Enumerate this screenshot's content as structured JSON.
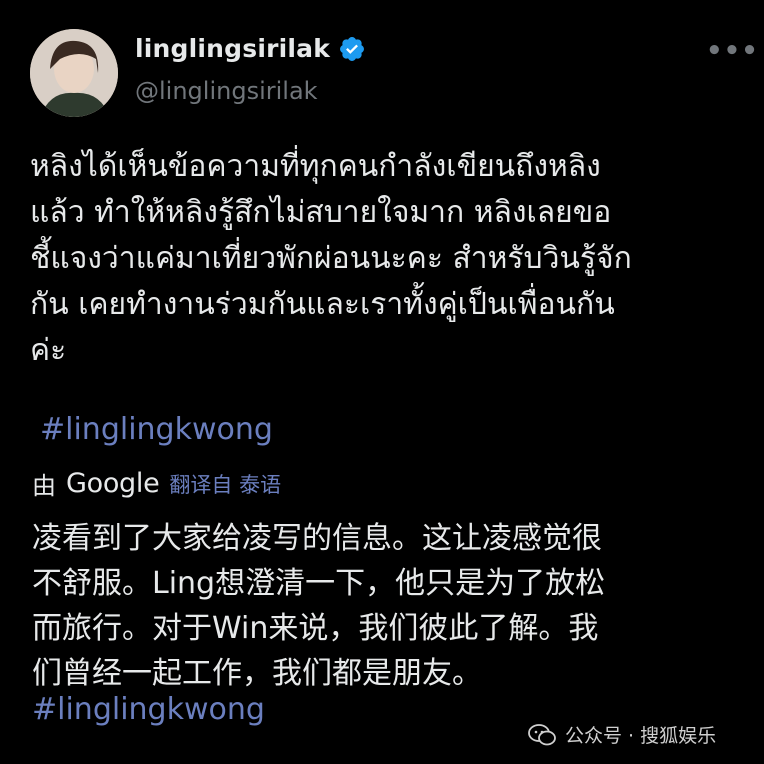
{
  "author": {
    "display_name": "linglingsirilak",
    "handle": "@linglingsirilak"
  },
  "more_icon": "ellipsis-icon",
  "verified_icon": "verified-badge-icon",
  "tweet": {
    "thai_lines": [
      "หลิงได้เห็นข้อความที่ทุกคนกำลังเขียนถึงหลิง",
      "แล้ว ทำให้หลิงรู้สึกไม่สบายใจมาก หลิงเลยขอ",
      "ชี้แจงว่าแค่มาเที่ยวพักผ่อนนะคะ สำหรับวินรู้จัก",
      "กัน เคยทำงานร่วมกันและเราทั้งคู่เป็นเพื่อนกัน",
      "ค่ะ"
    ],
    "hashtag": "#linglingkwong"
  },
  "translation": {
    "by_label": "由",
    "provider": "Google",
    "from_label": "翻译自 泰语",
    "lines": [
      "凌看到了大家给凌写的信息。这让凌感觉很",
      "不舒服。Ling想澄清一下，他只是为了放松",
      "而旅行。对于Win来说，我们彼此了解。我",
      "们曾经一起工作，我们都是朋友。"
    ],
    "hashtag": "#linglingkwong"
  },
  "watermark": {
    "icon": "wechat-icon",
    "text": "公众号 · 搜狐娱乐"
  },
  "colors": {
    "background": "#000000",
    "text": "#e7e9ea",
    "muted": "#71767b",
    "link": "#6b7fbf",
    "verified": "#1d9bf0"
  }
}
